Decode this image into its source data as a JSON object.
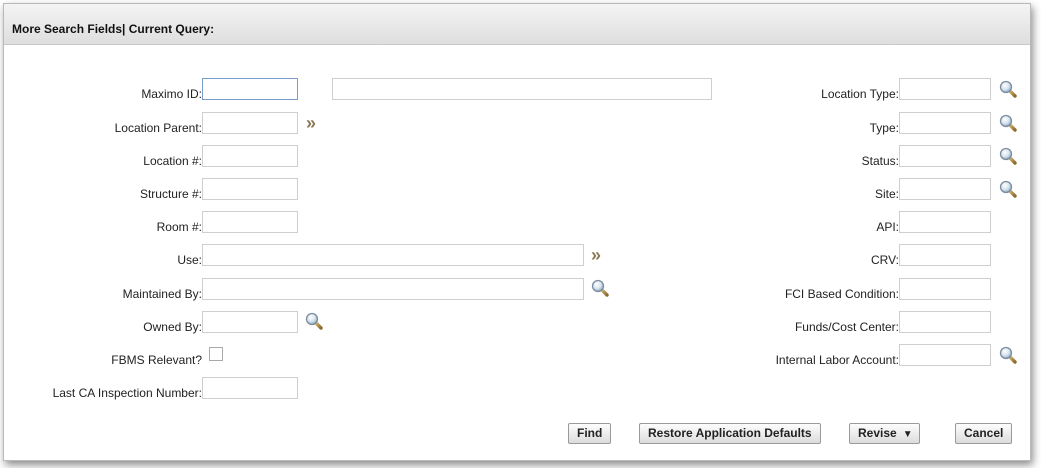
{
  "dialog": {
    "title": "More Search Fields| Current Query:"
  },
  "left_fields": {
    "maximo_id": {
      "label": "Maximo ID:",
      "value": ""
    },
    "location_parent": {
      "label": "Location Parent:",
      "value": ""
    },
    "location_num": {
      "label": "Location #:",
      "value": ""
    },
    "structure_num": {
      "label": "Structure #:",
      "value": ""
    },
    "room_num": {
      "label": "Room #:",
      "value": ""
    },
    "use": {
      "label": "Use:",
      "value": ""
    },
    "maintained_by": {
      "label": "Maintained By:",
      "value": ""
    },
    "owned_by": {
      "label": "Owned By:",
      "value": ""
    },
    "fbms_relevant": {
      "label": "FBMS Relevant?",
      "checked": false
    },
    "last_ca_inspection": {
      "label": "Last CA Inspection Number:",
      "value": ""
    }
  },
  "right_fields": {
    "location_type": {
      "label": "Location Type:",
      "value": ""
    },
    "type": {
      "label": "Type:",
      "value": ""
    },
    "status": {
      "label": "Status:",
      "value": ""
    },
    "site": {
      "label": "Site:",
      "value": ""
    },
    "api": {
      "label": "API:",
      "value": ""
    },
    "crv": {
      "label": "CRV:",
      "value": ""
    },
    "fci": {
      "label": "FCI Based Condition:",
      "value": ""
    },
    "funds": {
      "label": "Funds/Cost Center:",
      "value": ""
    },
    "internal_labor": {
      "label": "Internal Labor Account:",
      "value": ""
    }
  },
  "buttons": {
    "find": "Find",
    "restore": "Restore Application Defaults",
    "revise": "Revise",
    "cancel": "Cancel"
  },
  "icons": {
    "lookup": "magnifier-icon",
    "detail": "double-chevron-icon"
  },
  "colors": {
    "accent_focus_border": "#7a9cc8",
    "chevron": "#8b7a55"
  }
}
